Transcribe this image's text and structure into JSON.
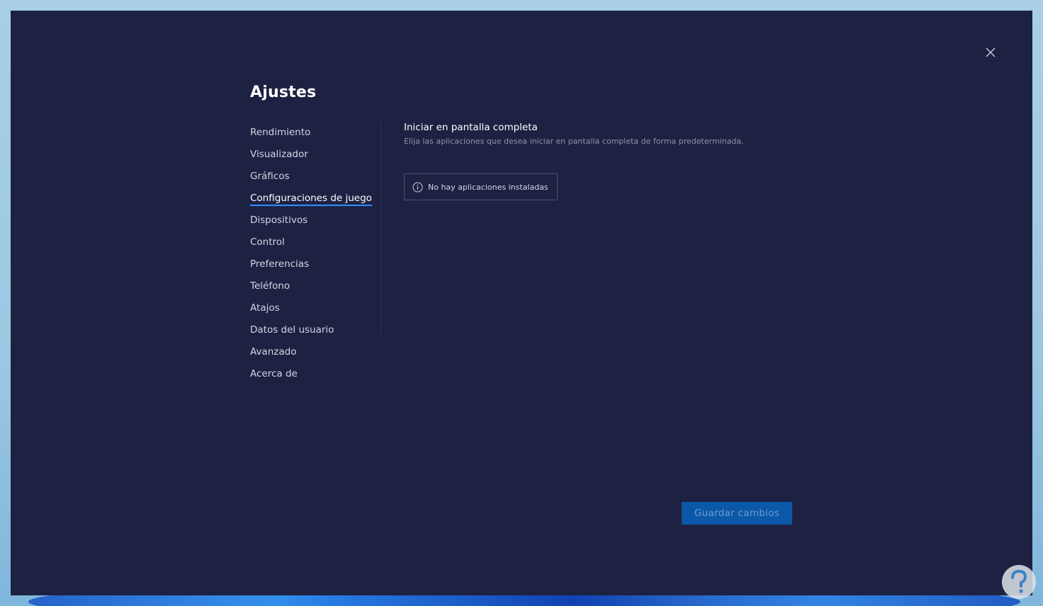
{
  "window": {
    "title": "Ajustes",
    "close_icon": "close-icon"
  },
  "sidebar": {
    "items": [
      {
        "label": "Rendimiento",
        "active": false
      },
      {
        "label": "Visualizador",
        "active": false
      },
      {
        "label": "Gráficos",
        "active": false
      },
      {
        "label": "Configuraciones de juego",
        "active": true
      },
      {
        "label": "Dispositivos",
        "active": false
      },
      {
        "label": "Control",
        "active": false
      },
      {
        "label": "Preferencias",
        "active": false
      },
      {
        "label": "Teléfono",
        "active": false
      },
      {
        "label": "Atajos",
        "active": false
      },
      {
        "label": "Datos del usuario",
        "active": false
      },
      {
        "label": "Avanzado",
        "active": false
      },
      {
        "label": "Acerca de",
        "active": false
      }
    ]
  },
  "content": {
    "section_title": "Iniciar en pantalla completa",
    "section_description": "Elija las aplicaciones que desea iniciar en pantalla completa de forma predeterminada.",
    "empty_state": {
      "icon": "info-icon",
      "text": "No hay aplicaciones instaladas"
    }
  },
  "footer": {
    "save_label": "Guardar cambios"
  },
  "colors": {
    "window_bg": "#1d2243",
    "accent": "#3a8bff",
    "save_button_bg": "#0b58a8",
    "muted_text": "#8e93ad"
  }
}
